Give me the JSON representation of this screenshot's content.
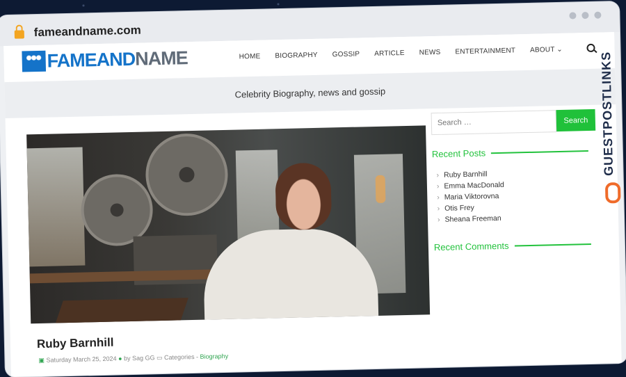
{
  "browser": {
    "url": "fameandname.com"
  },
  "site": {
    "logo": {
      "part1": "FAMEAND",
      "part2": "NAME"
    },
    "nav": [
      "HOME",
      "BIOGRAPHY",
      "GOSSIP",
      "ARTICLE",
      "NEWS",
      "ENTERTAINMENT",
      "ABOUT ⌄"
    ],
    "tagline": "Celebrity Biography, news and gossip"
  },
  "post": {
    "title": "Ruby Barnhill",
    "meta_date": "Saturday March 25, 2024",
    "meta_author": "by Sag GG",
    "meta_categories": "Categories -",
    "meta_category": "Biography"
  },
  "sidebar": {
    "search_placeholder": "Search …",
    "search_button": "Search",
    "recent_posts_title": "Recent Posts",
    "recent_posts": [
      "Ruby Barnhill",
      "Emma MacDonald",
      "Maria Viktorovna",
      "Otis Frey",
      "Sheana Freeman"
    ],
    "recent_comments_title": "Recent Comments"
  },
  "watermark": {
    "text": "GUESTPOSTLINKS"
  },
  "colors": {
    "accent": "#22c23c",
    "brand": "#1473c9"
  }
}
